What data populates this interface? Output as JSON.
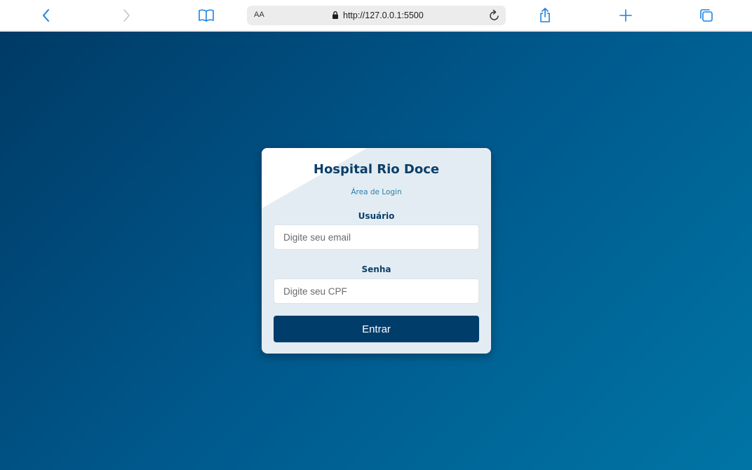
{
  "browser": {
    "text_size_label": "AA",
    "url": "http://127.0.0.1:5500",
    "icons": [
      "back-icon",
      "forward-icon",
      "bookmarks-icon",
      "lock-icon",
      "reload-icon",
      "share-icon",
      "new-tab-icon",
      "tabs-icon"
    ],
    "accent_color": "#1a82e2"
  },
  "login": {
    "title": "Hospital Rio Doce",
    "subtitle": "Área de Login",
    "user_label": "Usuário",
    "user_placeholder": "Digite seu email",
    "password_label": "Senha",
    "password_placeholder": "Digite seu CPF",
    "submit_label": "Entrar"
  },
  "colors": {
    "background_start": "#003a66",
    "background_end": "#0075a5",
    "card_background": "#e4ecf3",
    "title_color": "#0b3f6a",
    "subtitle_color": "#2a7fab",
    "button_color": "#003d6b"
  }
}
